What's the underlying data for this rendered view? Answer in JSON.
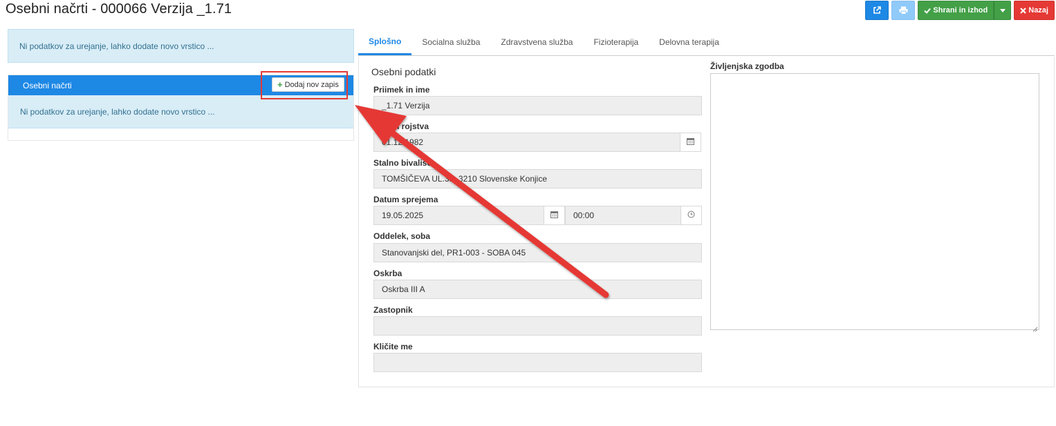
{
  "page": {
    "title": "Osebni načrti - 000066 Verzija _1.71"
  },
  "toolbar": {
    "external_icon": "external-link-icon",
    "print_icon": "print-icon",
    "save_label": "Shrani in izhod",
    "back_label": "Nazaj",
    "colors": {
      "blue": "#1e88e5",
      "light_blue": "#90caf9",
      "green": "#43a047",
      "red": "#e53935"
    }
  },
  "left": {
    "top_info": "Ni podatkov za urejanje, lahko dodate novo vrstico ...",
    "panel_title": "Osebni načrti",
    "add_button": "Dodaj nov zapis",
    "panel_info": "Ni podatkov za urejanje, lahko dodate novo vrstico ..."
  },
  "tabs": [
    {
      "label": "Splošno",
      "active": true
    },
    {
      "label": "Socialna služba",
      "active": false
    },
    {
      "label": "Zdravstvena služba",
      "active": false
    },
    {
      "label": "Fizioterapija",
      "active": false
    },
    {
      "label": "Delovna terapija",
      "active": false
    }
  ],
  "form": {
    "section_title": "Osebni podatki",
    "surname_label": "Priimek in ime",
    "surname_value": "_1.71 Verzija",
    "birth_label": "Datum rojstva",
    "birth_value": "01.12.1982",
    "residence_label": "Stalno bivališče",
    "residence_value": "TOMŠIČEVA UL.35, 3210 Slovenske Konjice",
    "admission_label": "Datum sprejema",
    "admission_date": "19.05.2025",
    "admission_time": "00:00",
    "ward_label": "Oddelek, soba",
    "ward_value": "Stanovanjski del, PR1-003 - SOBA 045",
    "care_label": "Oskrba",
    "care_value": "Oskrba III A",
    "representative_label": "Zastopnik",
    "representative_value": "",
    "callme_label": "Kličite me",
    "callme_value": ""
  },
  "story": {
    "label": "Življenjska zgodba",
    "value": ""
  },
  "annotation": {
    "color": "#e53935"
  }
}
